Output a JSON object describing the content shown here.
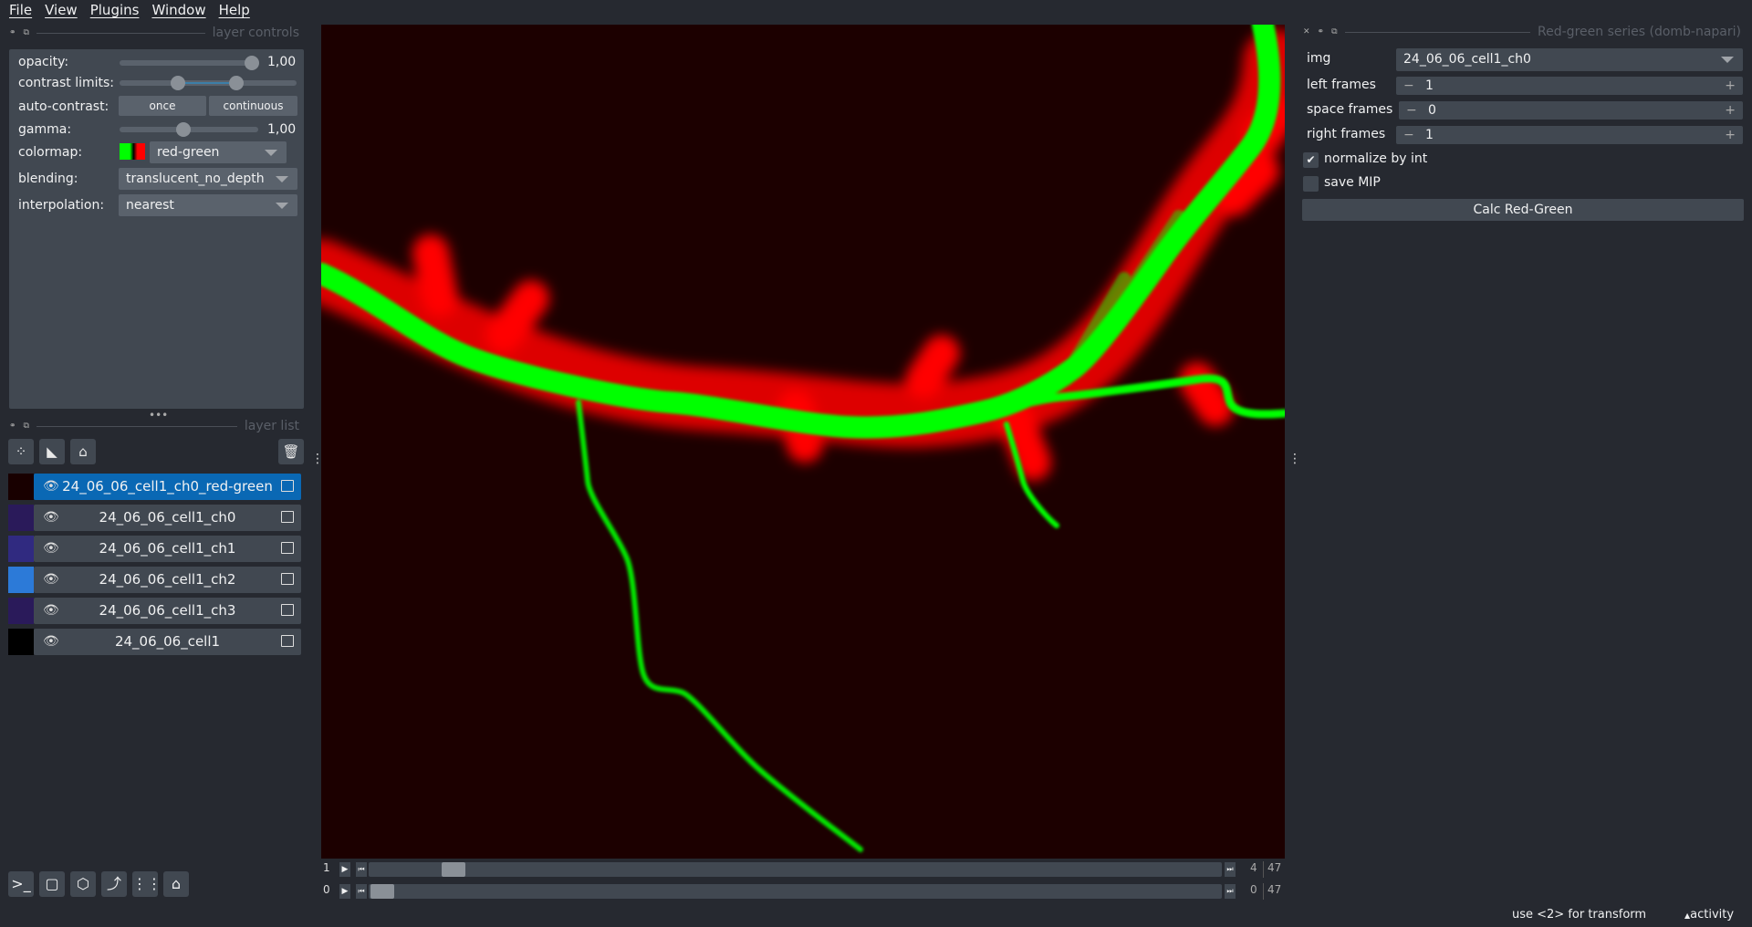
{
  "menu": [
    "File",
    "View",
    "Plugins",
    "Window",
    "Help"
  ],
  "layer_controls": {
    "title": "layer controls",
    "opacity_label": "opacity:",
    "opacity_value": "1,00",
    "opacity_fraction": 1.0,
    "contrast_label": "contrast limits:",
    "contrast_range": [
      0.3,
      0.65
    ],
    "auto_contrast_label": "auto-contrast:",
    "once": "once",
    "continuous": "continuous",
    "gamma_label": "gamma:",
    "gamma_value": "1,00",
    "gamma_fraction": 0.45,
    "colormap_label": "colormap:",
    "colormap": "red-green",
    "blending_label": "blending:",
    "blending": "translucent_no_depth",
    "interpolation_label": "interpolation:",
    "interpolation": "nearest"
  },
  "layer_list": {
    "title": "layer list",
    "layers": [
      {
        "name": "24_06_06_cell1_ch0_red-green",
        "selected": true
      },
      {
        "name": "24_06_06_cell1_ch0"
      },
      {
        "name": "24_06_06_cell1_ch1"
      },
      {
        "name": "24_06_06_cell1_ch2"
      },
      {
        "name": "24_06_06_cell1_ch3"
      },
      {
        "name": "24_06_06_cell1"
      }
    ]
  },
  "dims": [
    {
      "axis": "1",
      "value": "4",
      "max": "47"
    },
    {
      "axis": "0",
      "value": "0",
      "max": "47"
    }
  ],
  "plugin": {
    "title": "Red-green series (domb-napari)",
    "img_label": "img",
    "img_value": "24_06_06_cell1_ch0",
    "left_label": "left frames",
    "left_value": "1",
    "space_label": "space frames",
    "space_value": "0",
    "right_label": "right frames",
    "right_value": "1",
    "normalize_label": "normalize by int",
    "normalize_checked": true,
    "mip_label": "save MIP",
    "mip_checked": false,
    "calc_label": "Calc Red-Green"
  },
  "status": {
    "hint": "use <2> for transform",
    "activity": "activity"
  },
  "colors": {
    "accent": "#0a68b4",
    "green": "#00ff00",
    "red": "#ff0000"
  }
}
